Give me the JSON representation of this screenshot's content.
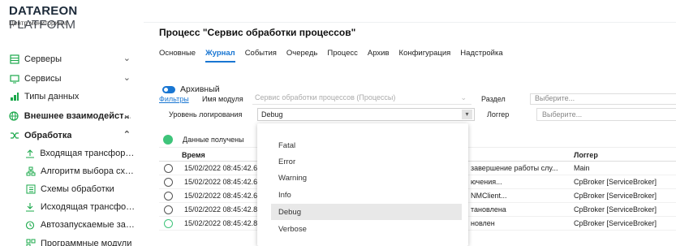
{
  "brand": {
    "name_bold": "DATAREON",
    "name_light": "PLATFORM",
    "subtitle": "Центр мониторинга"
  },
  "sidebar": {
    "items": [
      {
        "label": "Серверы",
        "icon": "server-icon",
        "chevron": "⌄"
      },
      {
        "label": "Сервисы",
        "icon": "monitor-icon",
        "chevron": "⌄"
      },
      {
        "label": "Типы данных",
        "icon": "data-types-icon"
      },
      {
        "label": "Внешнее взаимодейст…",
        "icon": "globe-icon",
        "chevron": "⌄"
      },
      {
        "label": "Обработка",
        "icon": "shuffle-icon",
        "chevron": "⌃"
      }
    ],
    "subitems": [
      {
        "label": "Входящая трансформа…",
        "icon": "upload-icon"
      },
      {
        "label": "Алгоритм выбора схе…",
        "icon": "network-icon"
      },
      {
        "label": "Схемы обработки",
        "icon": "list-icon"
      },
      {
        "label": "Исходящая трансфор…",
        "icon": "download-icon"
      },
      {
        "label": "Автозапускаемые зад…",
        "icon": "clock-icon"
      },
      {
        "label": "Программные модули",
        "icon": "modules-icon"
      }
    ]
  },
  "main": {
    "title": "Процесс \"Сервис обработки процессов\"",
    "tabs": [
      "Основные",
      "Журнал",
      "События",
      "Очередь",
      "Процесс",
      "Архив",
      "Конфигурация",
      "Надстройка"
    ],
    "active_tab": "Журнал",
    "archive_toggle": "Архивный",
    "filters_link": "Фильтры",
    "module_label": "Имя модуля",
    "module_value": "Сервис обработки процессов (Процессы)",
    "section_label": "Раздел",
    "section_placeholder": "Выберите...",
    "level_label": "Уровень логирования",
    "level_value": "Debug",
    "logger_label": "Логгер",
    "logger_placeholder": "Выберите...",
    "status_text": "Данные получены"
  },
  "table": {
    "headers": {
      "time": "Время",
      "logger": "Логгер"
    },
    "rows": [
      {
        "time": "15/02/2022 08:45:42.6",
        "message": "завершение работы слу...",
        "logger": "Main"
      },
      {
        "time": "15/02/2022 08:45:42.6",
        "message": "ючения...",
        "logger": "CpBroker [ServiceBroker]"
      },
      {
        "time": "15/02/2022 08:45:42.6",
        "message": "NMClient...",
        "logger": "CpBroker [ServiceBroker]"
      },
      {
        "time": "15/02/2022 08:45:42.8",
        "message": "тановлена",
        "logger": "CpBroker [ServiceBroker]"
      },
      {
        "time": "15/02/2022 08:45:42.8",
        "message": "новлен",
        "logger": "CpBroker [ServiceBroker]"
      }
    ]
  },
  "dropdown": {
    "options": [
      "Fatal",
      "Error",
      "Warning",
      "Info",
      "Debug",
      "Verbose"
    ],
    "selected": "Debug"
  },
  "colors": {
    "accent": "#1976d2",
    "green": "#3ec47a",
    "brand": "#1d2b3a"
  }
}
